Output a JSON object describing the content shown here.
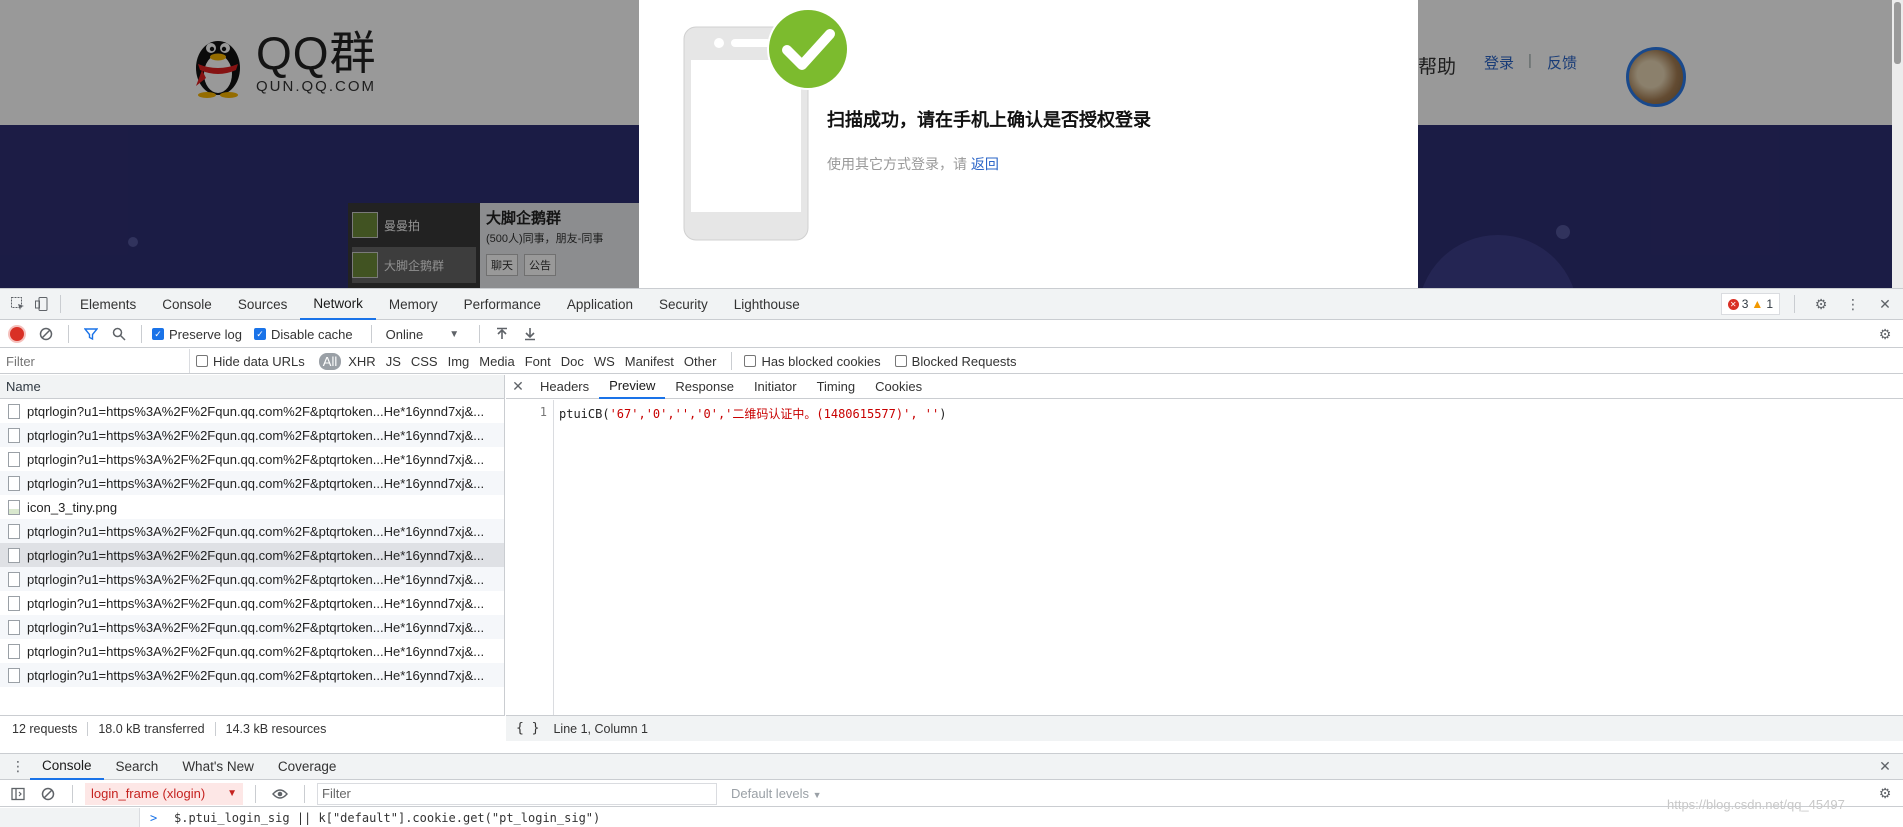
{
  "site": {
    "logo_main": "QQ群",
    "logo_sub": "QUN.QQ.COM",
    "nav_help": "帮助",
    "nav_login": "登录",
    "nav_separator": "|",
    "nav_feedback": "反馈",
    "banner_group_title": "大脚企鹅群",
    "banner_group_sub": "(500人)同事，朋友-同事",
    "banner_list_item_1": "曼曼拍",
    "banner_list_item_2": "大脚企鹅群",
    "banner_btn_chat": "聊天",
    "banner_btn_notice": "公告"
  },
  "modal": {
    "title": "扫描成功，请在手机上确认是否授权登录",
    "alt_prefix": "使用其它方式登录，请",
    "alt_link": "返回",
    "accent": "#7cbb2e"
  },
  "devtools": {
    "tabs": [
      {
        "label": "Elements"
      },
      {
        "label": "Console"
      },
      {
        "label": "Sources"
      },
      {
        "label": "Network"
      },
      {
        "label": "Memory"
      },
      {
        "label": "Performance"
      },
      {
        "label": "Application"
      },
      {
        "label": "Security"
      },
      {
        "label": "Lighthouse"
      }
    ],
    "active_tab": "Network",
    "error_count": "3",
    "warning_count": "1",
    "toolbar": {
      "preserve_log": "Preserve log",
      "disable_cache": "Disable cache",
      "throttling": "Online"
    },
    "filter": {
      "placeholder": "Filter",
      "hide_data_urls": "Hide data URLs",
      "types": [
        "All",
        "XHR",
        "JS",
        "CSS",
        "Img",
        "Media",
        "Font",
        "Doc",
        "WS",
        "Manifest",
        "Other"
      ],
      "has_blocked_cookies": "Has blocked cookies",
      "blocked_requests": "Blocked Requests"
    },
    "requests": {
      "column_name": "Name",
      "rows": [
        {
          "name": "ptqrlogin?u1=https%3A%2F%2Fqun.qq.com%2F&ptqrtoken...He*16ynnd7xj&...",
          "kind": "doc"
        },
        {
          "name": "ptqrlogin?u1=https%3A%2F%2Fqun.qq.com%2F&ptqrtoken...He*16ynnd7xj&...",
          "kind": "doc"
        },
        {
          "name": "ptqrlogin?u1=https%3A%2F%2Fqun.qq.com%2F&ptqrtoken...He*16ynnd7xj&...",
          "kind": "doc"
        },
        {
          "name": "ptqrlogin?u1=https%3A%2F%2Fqun.qq.com%2F&ptqrtoken...He*16ynnd7xj&...",
          "kind": "doc"
        },
        {
          "name": "icon_3_tiny.png",
          "kind": "img"
        },
        {
          "name": "ptqrlogin?u1=https%3A%2F%2Fqun.qq.com%2F&ptqrtoken...He*16ynnd7xj&...",
          "kind": "doc"
        },
        {
          "name": "ptqrlogin?u1=https%3A%2F%2Fqun.qq.com%2F&ptqrtoken...He*16ynnd7xj&...",
          "kind": "doc",
          "selected": true
        },
        {
          "name": "ptqrlogin?u1=https%3A%2F%2Fqun.qq.com%2F&ptqrtoken...He*16ynnd7xj&...",
          "kind": "doc"
        },
        {
          "name": "ptqrlogin?u1=https%3A%2F%2Fqun.qq.com%2F&ptqrtoken...He*16ynnd7xj&...",
          "kind": "doc"
        },
        {
          "name": "ptqrlogin?u1=https%3A%2F%2Fqun.qq.com%2F&ptqrtoken...He*16ynnd7xj&...",
          "kind": "doc"
        },
        {
          "name": "ptqrlogin?u1=https%3A%2F%2Fqun.qq.com%2F&ptqrtoken...He*16ynnd7xj&...",
          "kind": "doc"
        },
        {
          "name": "ptqrlogin?u1=https%3A%2F%2Fqun.qq.com%2F&ptqrtoken...He*16ynnd7xj&...",
          "kind": "doc"
        }
      ],
      "status_requests": "12 requests",
      "status_transferred": "18.0 kB transferred",
      "status_resources": "14.3 kB resources"
    },
    "detail": {
      "tabs": [
        "Headers",
        "Preview",
        "Response",
        "Initiator",
        "Timing",
        "Cookies"
      ],
      "active_tab": "Preview",
      "line_number": "1",
      "code_prefix": "ptuiCB(",
      "code_args": "'67','0','','0','二维码认证中。(1480615577)', ''",
      "code_suffix": ")",
      "cursor": "Line 1, Column 1"
    },
    "drawer": {
      "tabs": [
        "Console",
        "Search",
        "What's New",
        "Coverage"
      ],
      "active_tab": "Console",
      "context": "login_frame (xlogin)",
      "filter_placeholder": "Filter",
      "levels": "Default levels",
      "prompt": ">",
      "input_text": "$.ptui_login_sig || k[\"default\"].cookie.get(\"pt_login_sig\")"
    }
  },
  "watermark": "https://blog.csdn.net/qq_45497"
}
